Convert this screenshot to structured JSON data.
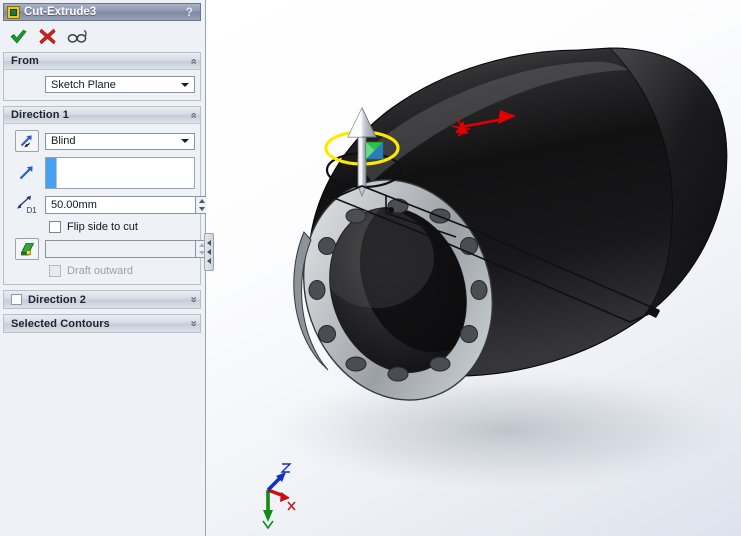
{
  "window": {
    "title": "Cut-Extrude3",
    "help_label": "?",
    "icon": "cut-extrude-feature-icon"
  },
  "toolbar": {
    "accept_label": "✔",
    "accept_name": "ok-checkmark-button",
    "cancel_label": "✖",
    "cancel_name": "cancel-x-button",
    "preview_name": "detailed-preview-glasses-button"
  },
  "sections": {
    "from": {
      "title": "From",
      "collapse_glyph": "«",
      "start_condition": "Sketch Plane"
    },
    "direction1": {
      "title": "Direction 1",
      "collapse_glyph": "«",
      "reverse_direction_icon": "reverse-direction-arrow-icon",
      "end_condition": "Blind",
      "face_direction_icon": "direction-vector-arrow-icon",
      "face_selection_value": "",
      "depth_icon": "depth-dimension-d1-icon",
      "depth_value": "50.00mm",
      "flip_side_label": "Flip side to cut",
      "flip_side_checked": false,
      "draft_icon": "draft-angle-icon",
      "draft_value": "",
      "draft_outward_label": "Draft outward",
      "draft_outward_checked": false,
      "draft_outward_enabled": false
    },
    "direction2": {
      "title": "Direction 2",
      "expand_glyph": "»",
      "enabled": false
    },
    "selected_contours": {
      "title": "Selected Contours",
      "expand_glyph": "»"
    }
  },
  "splitter": {
    "name": "panel-splitter-handle",
    "glyph": "◂"
  },
  "viewport": {
    "model_name": "flanged-cylindrical-tube",
    "background": "#eef1f8",
    "body_color": "#1a1a1a",
    "flange_color": "#b8bcc0",
    "highlight_color": "#ffe800",
    "direction_arrow_color": "#e00000",
    "sketch_line_color": "#1a1a1a",
    "manipulator_color": "#c8cdd4",
    "bolt_hole_count": 12,
    "triad": {
      "x_label": "X",
      "x_color": "#c81010",
      "y_label": "Y",
      "y_color": "#0f8a14",
      "z_label": "Z",
      "z_color": "#1030c8"
    }
  }
}
